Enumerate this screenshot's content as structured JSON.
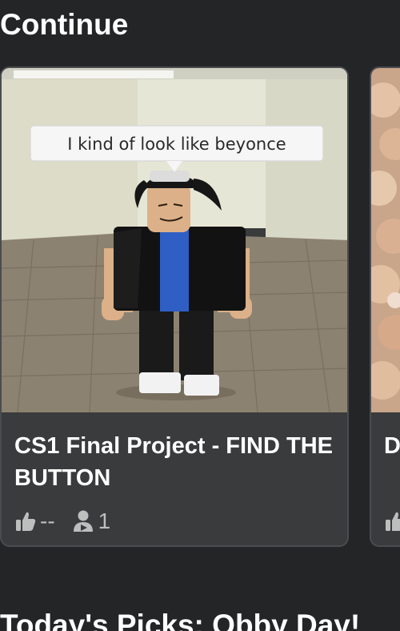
{
  "sections": {
    "continue_title": "Continue",
    "next_title": "Today's Picks: Obby Day!"
  },
  "cards": [
    {
      "title": "CS1 Final Project - FIND THE BUTTON",
      "thumbnail_caption": "I kind of look like beyonce",
      "likes": "--",
      "players": "1"
    },
    {
      "title": "D",
      "likes": "",
      "players": ""
    }
  ],
  "icons": {
    "like": "thumbs-up-icon",
    "players": "player-count-icon"
  },
  "colors": {
    "background": "#232527",
    "card": "#393b3d",
    "card_border": "#4a4c4f",
    "text": "#ffffff",
    "muted": "#bdbebe"
  }
}
